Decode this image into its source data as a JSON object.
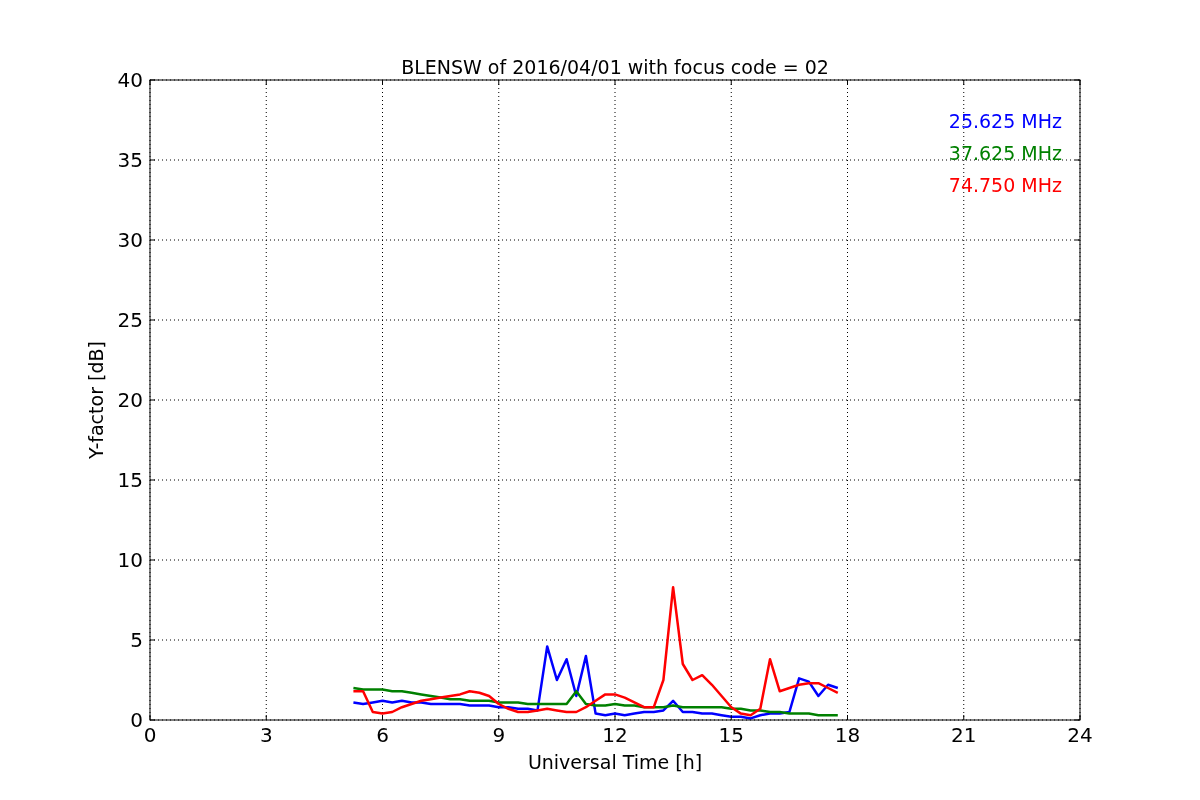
{
  "chart_data": {
    "type": "line",
    "grid": true,
    "title": "BLENSW of 2016/04/01 with focus code = 02",
    "xlabel": "Universal Time [h]",
    "ylabel": "Y-factor [dB]",
    "xlim": [
      0,
      24
    ],
    "ylim": [
      0,
      40
    ],
    "xticks": [
      0,
      3,
      6,
      9,
      12,
      15,
      18,
      21,
      24
    ],
    "yticks": [
      0,
      5,
      10,
      15,
      20,
      25,
      30,
      35,
      40
    ],
    "x": [
      5.25,
      5.5,
      5.75,
      6,
      6.25,
      6.5,
      6.75,
      7,
      7.25,
      7.5,
      7.75,
      8,
      8.25,
      8.5,
      8.75,
      9,
      9.25,
      9.5,
      9.75,
      10,
      10.25,
      10.5,
      10.75,
      11,
      11.25,
      11.5,
      11.75,
      12,
      12.25,
      12.5,
      12.75,
      13,
      13.25,
      13.5,
      13.75,
      14,
      14.25,
      14.5,
      14.75,
      15,
      15.25,
      15.5,
      15.75,
      16,
      16.25,
      16.5,
      16.75,
      17,
      17.25,
      17.5,
      17.75
    ],
    "series": [
      {
        "name": "25.625 MHz",
        "color": "#0000ff",
        "values": [
          1.1,
          1.0,
          1.1,
          1.2,
          1.1,
          1.2,
          1.1,
          1.1,
          1.0,
          1.0,
          1.0,
          1.0,
          0.9,
          0.9,
          0.9,
          0.8,
          0.8,
          0.7,
          0.7,
          0.6,
          4.6,
          2.5,
          3.8,
          1.5,
          4.0,
          0.4,
          0.3,
          0.4,
          0.3,
          0.4,
          0.5,
          0.5,
          0.6,
          1.2,
          0.5,
          0.5,
          0.4,
          0.4,
          0.3,
          0.2,
          0.2,
          0.1,
          0.3,
          0.4,
          0.4,
          0.5,
          2.6,
          2.4,
          1.5,
          2.2,
          2.0
        ]
      },
      {
        "name": "37.625 MHz",
        "color": "#008000",
        "values": [
          2.0,
          1.9,
          1.9,
          1.9,
          1.8,
          1.8,
          1.7,
          1.6,
          1.5,
          1.4,
          1.3,
          1.3,
          1.2,
          1.2,
          1.2,
          1.1,
          1.1,
          1.1,
          1.0,
          1.0,
          1.0,
          1.0,
          1.0,
          1.8,
          1.0,
          0.9,
          0.9,
          1.0,
          0.9,
          0.9,
          0.8,
          0.8,
          0.8,
          0.9,
          0.8,
          0.8,
          0.8,
          0.8,
          0.8,
          0.7,
          0.7,
          0.6,
          0.6,
          0.5,
          0.5,
          0.4,
          0.4,
          0.4,
          0.3,
          0.3,
          0.3
        ]
      },
      {
        "name": "74.750 MHz",
        "color": "#ff0000",
        "values": [
          1.8,
          1.8,
          0.5,
          0.4,
          0.5,
          0.8,
          1.0,
          1.2,
          1.3,
          1.4,
          1.5,
          1.6,
          1.8,
          1.7,
          1.5,
          1.0,
          0.7,
          0.5,
          0.5,
          0.6,
          0.7,
          0.6,
          0.5,
          0.5,
          0.8,
          1.2,
          1.6,
          1.6,
          1.4,
          1.1,
          0.8,
          0.8,
          2.5,
          8.3,
          3.5,
          2.5,
          2.8,
          2.2,
          1.5,
          0.8,
          0.4,
          0.3,
          0.7,
          3.8,
          1.8,
          2.0,
          2.2,
          2.3,
          2.3,
          2.0,
          1.7
        ]
      }
    ]
  }
}
